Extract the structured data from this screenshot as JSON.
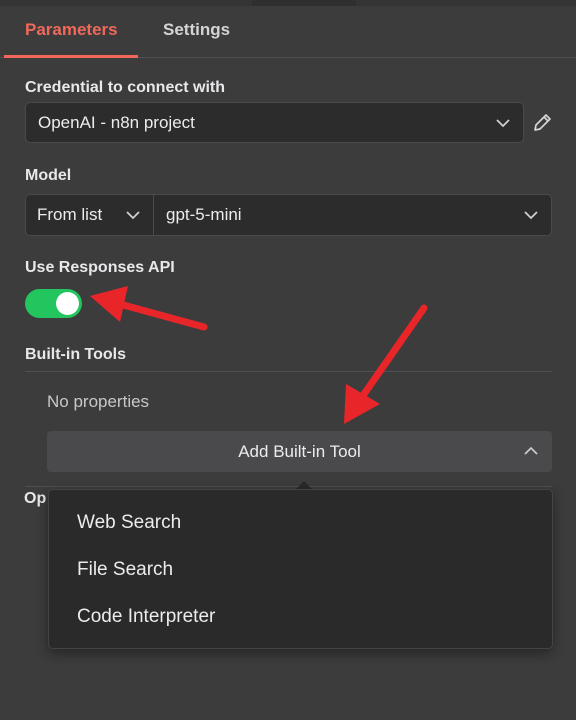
{
  "tabs": [
    {
      "label": "Parameters",
      "active": true
    },
    {
      "label": "Settings",
      "active": false
    }
  ],
  "credential": {
    "label": "Credential to connect with",
    "value": "OpenAI - n8n project"
  },
  "model": {
    "label": "Model",
    "mode": "From list",
    "value": "gpt-5-mini"
  },
  "responses_api": {
    "label": "Use Responses API",
    "enabled": true
  },
  "builtin_tools": {
    "label": "Built-in Tools",
    "empty_text": "No properties",
    "add_button": "Add Built-in Tool",
    "menu_items": [
      "Web Search",
      "File Search",
      "Code Interpreter"
    ]
  },
  "options": {
    "label_fragment": "Op"
  },
  "colors": {
    "accent": "#f0685a",
    "toggle_on": "#22c55e",
    "annotation_arrow": "#e8262a"
  },
  "icons": {
    "credential_edit": "pencil-icon",
    "dropdown": "chevron-down-icon",
    "collapse": "chevron-up-icon"
  }
}
